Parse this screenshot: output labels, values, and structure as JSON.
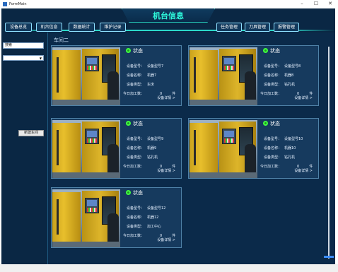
{
  "window": {
    "title": "FormMain"
  },
  "header": {
    "title": "机台信息",
    "left_nav": [
      "设备总览",
      "机台信息",
      "数据统计",
      "维护记录"
    ],
    "right_nav": [
      "任务管理",
      "刀具管理",
      "报警管理"
    ]
  },
  "left": {
    "search_value": "搜索",
    "select_value": "",
    "button_label": "新建车间"
  },
  "main": {
    "workshop_label": "车间二",
    "field_labels": {
      "model": "设备型号：",
      "name": "设备名称：",
      "type": "设备类型：",
      "today": "今日加工数："
    },
    "status_label": "状态",
    "detail_label": "设备详情 >",
    "unit_label": "件",
    "cards": [
      {
        "model": "设备型号7",
        "name": "机器7",
        "type": "车床",
        "count": "0",
        "status_color": "#41ff41"
      },
      {
        "model": "设备型号8",
        "name": "机器8",
        "type": "钻孔机",
        "count": "0",
        "status_color": "#41ff41"
      },
      {
        "model": "设备型号9",
        "name": "机器9",
        "type": "钻孔机",
        "count": "0",
        "status_color": "#41ff41"
      },
      {
        "model": "设备型号10",
        "name": "机器10",
        "type": "钻孔机",
        "count": "0",
        "status_color": "#41ff41"
      },
      {
        "model": "设备型号12",
        "name": "机器12",
        "type": "加工中心",
        "count": "0",
        "status_color": "#41ff41"
      }
    ]
  }
}
